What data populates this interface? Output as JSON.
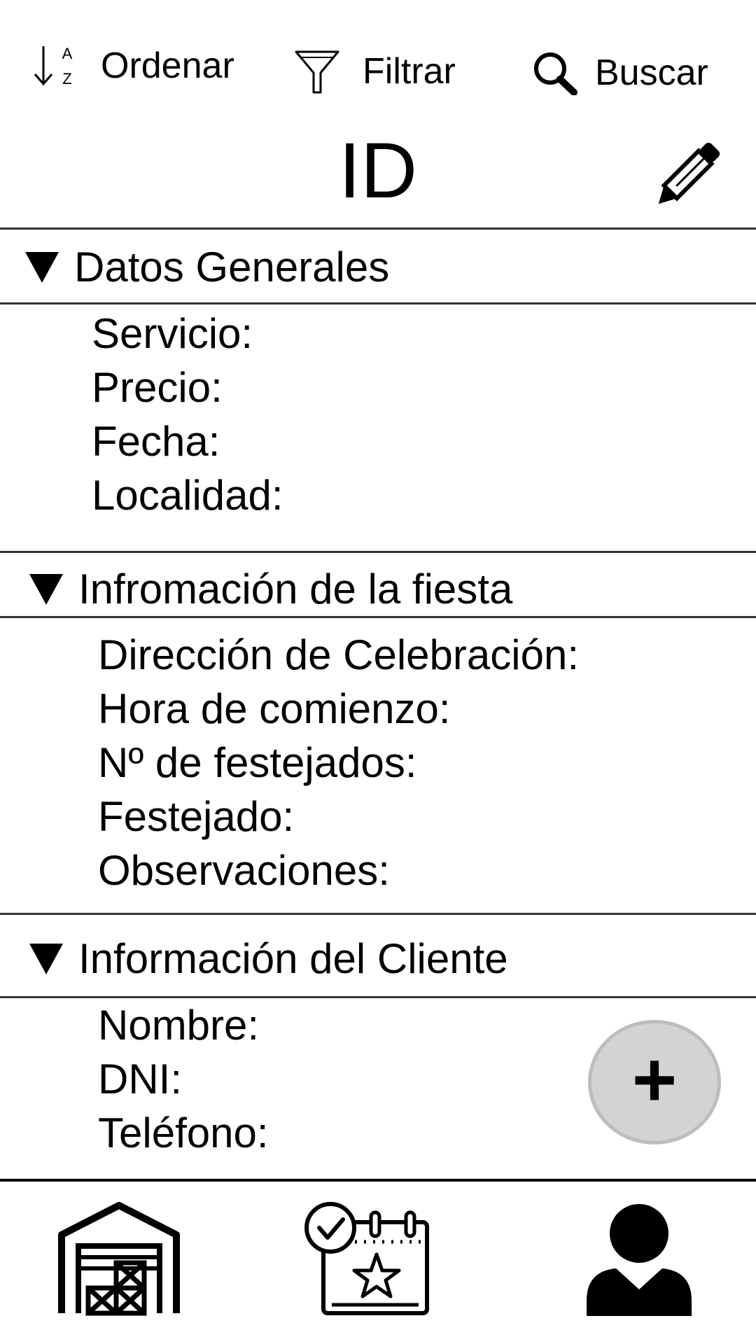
{
  "toolbar": {
    "sort_label": "Ordenar",
    "sort_icon_top": "A",
    "sort_icon_bottom": "Z",
    "filter_label": "Filtrar",
    "search_label": "Buscar"
  },
  "header": {
    "title": "ID",
    "edit_icon": "pencil-icon"
  },
  "sections": [
    {
      "title": "Datos Generales",
      "fields": [
        "Servicio:",
        "Precio:",
        "Fecha:",
        "Localidad:"
      ]
    },
    {
      "title": "Infromación de la fiesta",
      "fields": [
        "Dirección de Celebración:",
        "Hora de comienzo:",
        "Nº de festejados:",
        "Festejado:",
        "Observaciones:"
      ]
    },
    {
      "title": "Información del Cliente",
      "fields": [
        "Nombre:",
        "DNI:",
        "Teléfono:"
      ]
    }
  ],
  "fab": {
    "label": "+"
  },
  "bottom_nav": [
    "warehouse-icon",
    "event-calendar-icon",
    "user-icon"
  ],
  "colors": {
    "fab_bg": "#d3d3d3",
    "fab_border": "#bdbdbd",
    "divider": "#333333"
  }
}
